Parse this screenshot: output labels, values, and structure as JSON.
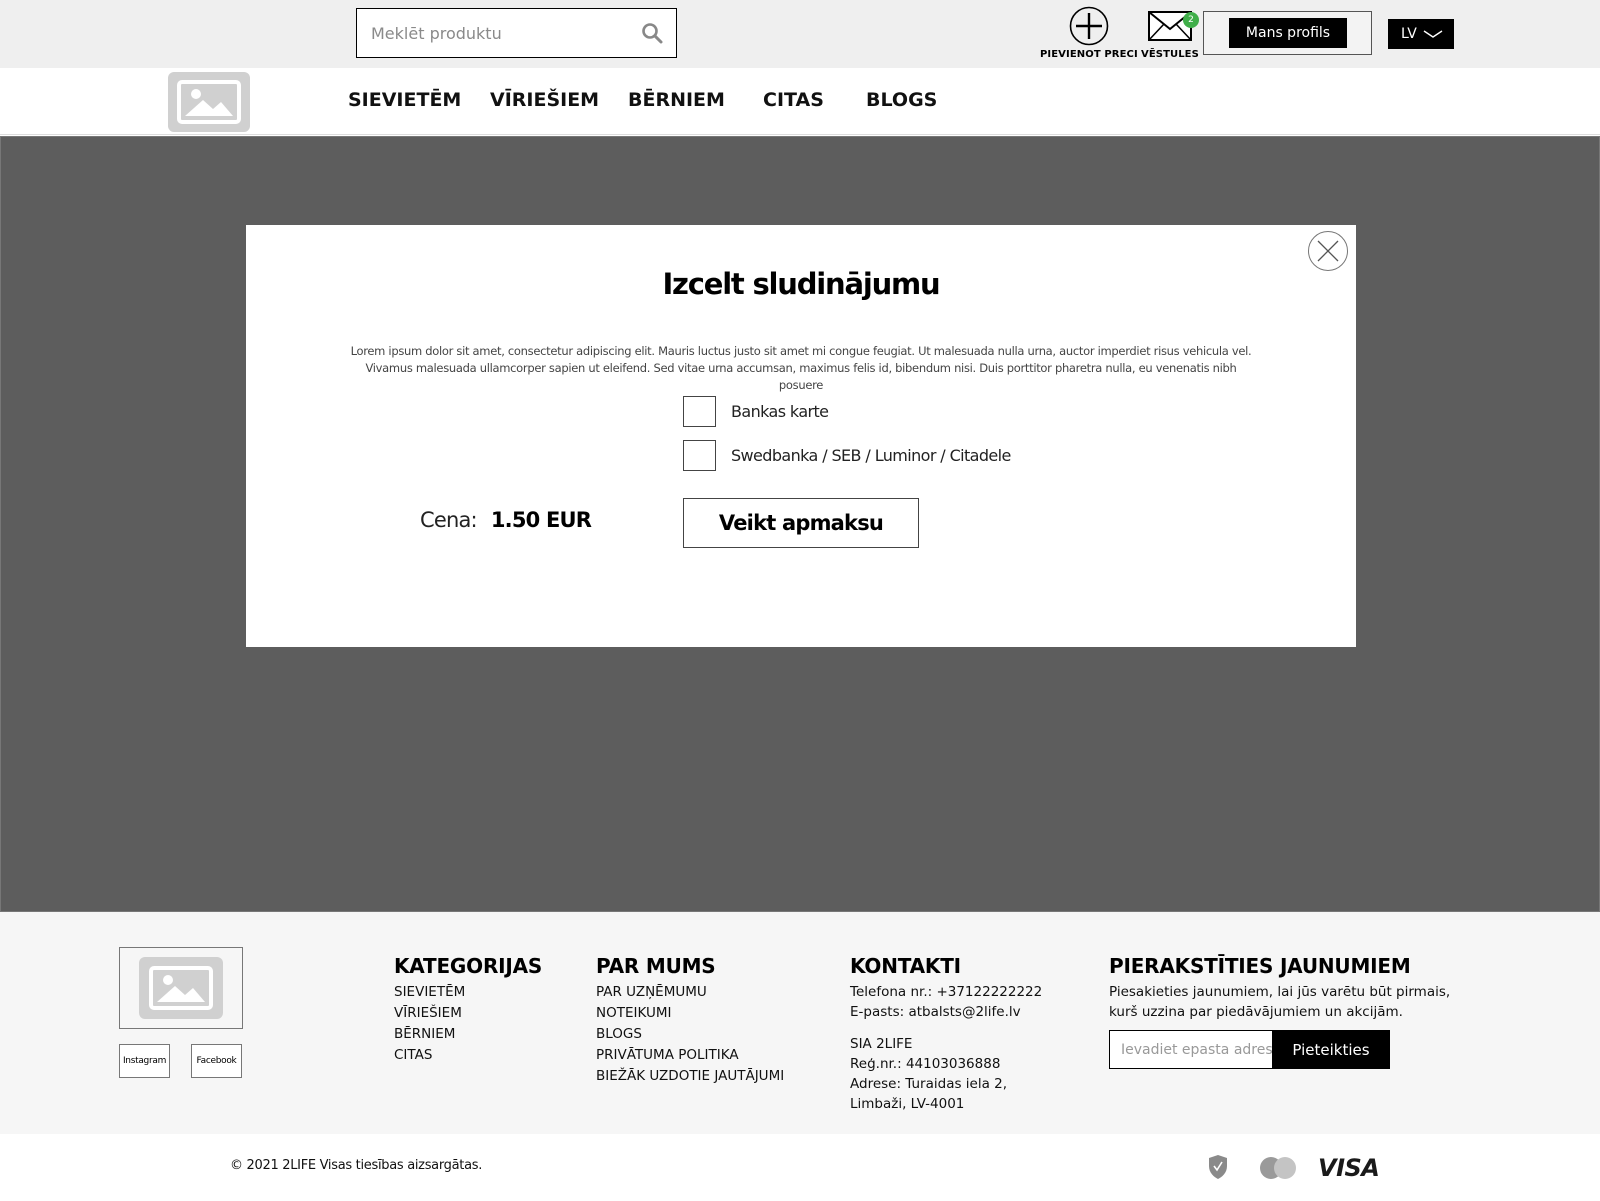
{
  "header": {
    "search_placeholder": "Meklēt produktu",
    "add_label": "PIEVIENOT PRECI",
    "messages_label": "VĒSTULES",
    "messages_count": "2",
    "profile_label": "Mans profils",
    "language": "LV"
  },
  "nav": {
    "items": [
      "SIEVIETĒM",
      "VĪRIEŠIEM",
      "BĒRNIEM",
      "CITAS",
      "BLOGS"
    ]
  },
  "modal": {
    "title": "Izcelt sludinājumu",
    "description_line1": "Lorem ipsum dolor sit amet, consectetur adipiscing elit. Mauris luctus justo sit amet mi congue feugiat. Ut malesuada nulla urna, auctor imperdiet risus vehicula vel.",
    "description_line2": "Vivamus malesuada ullamcorper sapien ut eleifend. Sed vitae urna accumsan, maximus felis id, bibendum nisi. Duis porttitor pharetra nulla, eu venenatis nibh posuere",
    "options": [
      "Bankas karte",
      "Swedbanka / SEB / Luminor / Citadele"
    ],
    "price_label": "Cena:",
    "price_value": "1.50 EUR",
    "pay_button": "Veikt apmaksu"
  },
  "footer": {
    "social": [
      "Instagram",
      "Facebook"
    ],
    "categories": {
      "title": "KATEGORIJAS",
      "items": [
        "SIEVIETĒM",
        "VĪRIEŠIEM",
        "BĒRNIEM",
        "CITAS"
      ]
    },
    "about": {
      "title": "PAR MUMS",
      "items": [
        "PAR UZŅĒMUMU",
        "NOTEIKUMI",
        "BLOGS",
        "PRIVĀTUMA POLITIKA",
        "BIEŽĀK UZDOTIE JAUTĀJUMI"
      ]
    },
    "contacts": {
      "title": "KONTAKTI",
      "phone": "Telefona nr.: +37122222222",
      "email": "E-pasts:  atbalsts@2life.lv",
      "company": "SIA 2LIFE",
      "reg": "Reģ.nr.: 44103036888",
      "address1": "Adrese: Turaidas iela 2,",
      "address2": "Limbaži, LV-4001"
    },
    "newsletter": {
      "title": "PIERAKSTĪTIES JAUNUMIEM",
      "text": "Piesakieties jaunumiem, lai jūs varētu būt pirmais, kurš uzzina par piedāvājumiem un akcijām.",
      "placeholder": "Ievadiet epasta adresi",
      "button": "Pieteikties"
    },
    "copyright": "© 2021 2LIFE Visas tiesības aizsargātas.",
    "payment_icons": [
      "shield-check-icon",
      "mastercard-icon",
      "visa-icon"
    ],
    "visa_text": "VISA"
  }
}
